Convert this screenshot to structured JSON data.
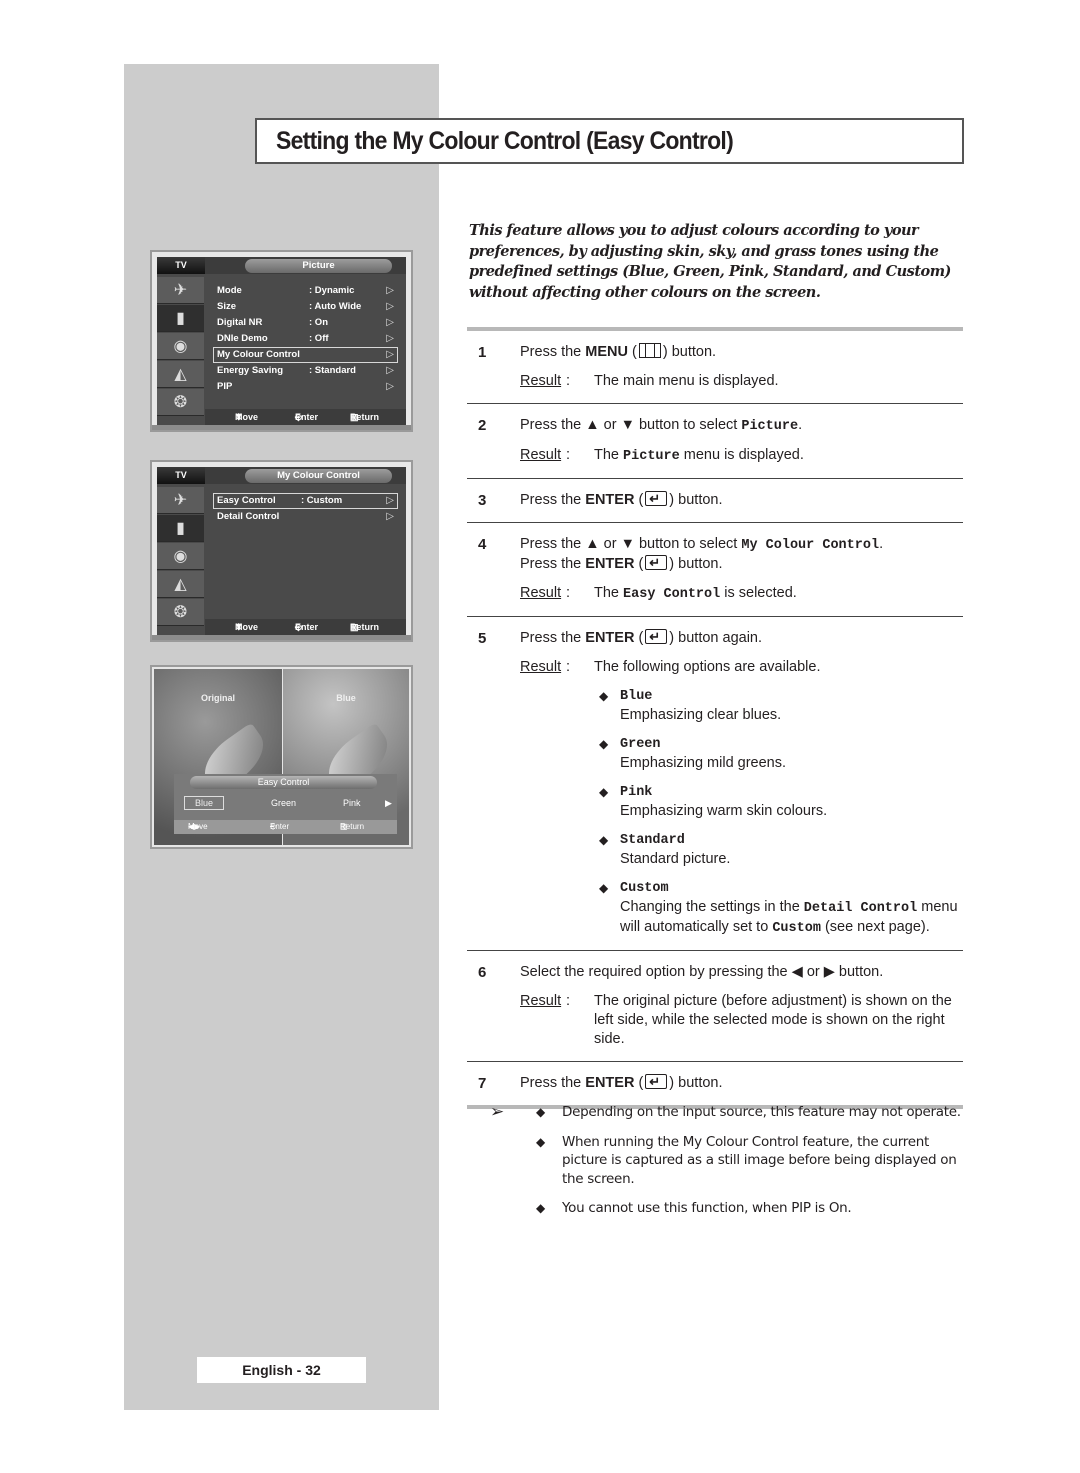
{
  "title": "Setting the My Colour Control (Easy Control)",
  "intro": "This feature allows you to adjust colours according to your preferences, by adjusting skin, sky, and grass tones using the predefined settings (Blue, Green, Pink, Standard, and Custom) without affecting other colours on the screen.",
  "osd_picture": {
    "tv_label": "TV",
    "title": "Picture",
    "rows": [
      {
        "label": "Mode",
        "value": ": Dynamic"
      },
      {
        "label": "Size",
        "value": ": Auto Wide"
      },
      {
        "label": "Digital NR",
        "value": ": On"
      },
      {
        "label": "DNIe Demo",
        "value": ": Off"
      },
      {
        "label": "My Colour Control",
        "value": ""
      },
      {
        "label": "Energy Saving",
        "value": ": Standard"
      },
      {
        "label": "PIP",
        "value": ""
      }
    ],
    "selected_index": 4,
    "footer": {
      "move": "Move",
      "enter": "Enter",
      "return": "Return"
    }
  },
  "osd_mycolour": {
    "tv_label": "TV",
    "title": "My Colour Control",
    "rows": [
      {
        "label": "Easy Control",
        "value": ": Custom"
      },
      {
        "label": "Detail Control",
        "value": ""
      }
    ],
    "selected_index": 0,
    "footer": {
      "move": "Move",
      "enter": "Enter",
      "return": "Return"
    }
  },
  "preview": {
    "left_label": "Original",
    "right_label": "Blue",
    "panel_title": "Easy Control",
    "options": [
      "Blue",
      "Green",
      "Pink"
    ],
    "selected_option": "Blue",
    "footer": {
      "move": "Move",
      "enter": "Enter",
      "return": "Return"
    }
  },
  "steps": [
    {
      "num": "1",
      "pre": "Press the ",
      "key": "MENU",
      "post": " button.",
      "result": "The main menu is displayed."
    },
    {
      "num": "2",
      "text_a": "Press the ▲ or ▼ button to select ",
      "mono": "Picture",
      "text_b": ".",
      "result_a": "The ",
      "result_mono": "Picture",
      "result_b": " menu is displayed."
    },
    {
      "num": "3",
      "pre": "Press the ",
      "key": "ENTER",
      "post": " button."
    },
    {
      "num": "4",
      "text_a": "Press the ▲ or ▼ button to select ",
      "mono": "My Colour Control",
      "text_b": ".",
      "line2_pre": "Press the ",
      "line2_key": "ENTER",
      "line2_post": " button.",
      "result_a": "The ",
      "result_mono": "Easy Control",
      "result_b": " is selected."
    },
    {
      "num": "5",
      "pre": "Press the ",
      "key": "ENTER",
      "post": " button again.",
      "result": "The following options are available."
    },
    {
      "num": "6",
      "text": "Select the required option by pressing the ◀ or ▶ button.",
      "result": "The original picture (before adjustment) is shown on the left side, while the selected mode is shown on the right side."
    },
    {
      "num": "7",
      "pre": "Press the ",
      "key": "ENTER",
      "post": " button."
    }
  ],
  "result_label": "Result",
  "options": [
    {
      "name": "Blue",
      "desc": "Emphasizing clear blues."
    },
    {
      "name": "Green",
      "desc": "Emphasizing mild greens."
    },
    {
      "name": "Pink",
      "desc": "Emphasizing warm skin colours."
    },
    {
      "name": "Standard",
      "desc": "Standard picture."
    },
    {
      "name": "Custom",
      "desc_a": "Changing the settings in the ",
      "desc_mono": "Detail Control",
      "desc_b": " menu will automatically set to ",
      "desc_mono2": "Custom",
      "desc_c": " (see next page)."
    }
  ],
  "notes": [
    "Depending on the input source, this feature may not operate.",
    "When running the My Colour Control feature, the current picture is captured as a still image before being displayed on the screen.",
    "You cannot use this function, when PIP is On."
  ],
  "page_number": "English - 32"
}
